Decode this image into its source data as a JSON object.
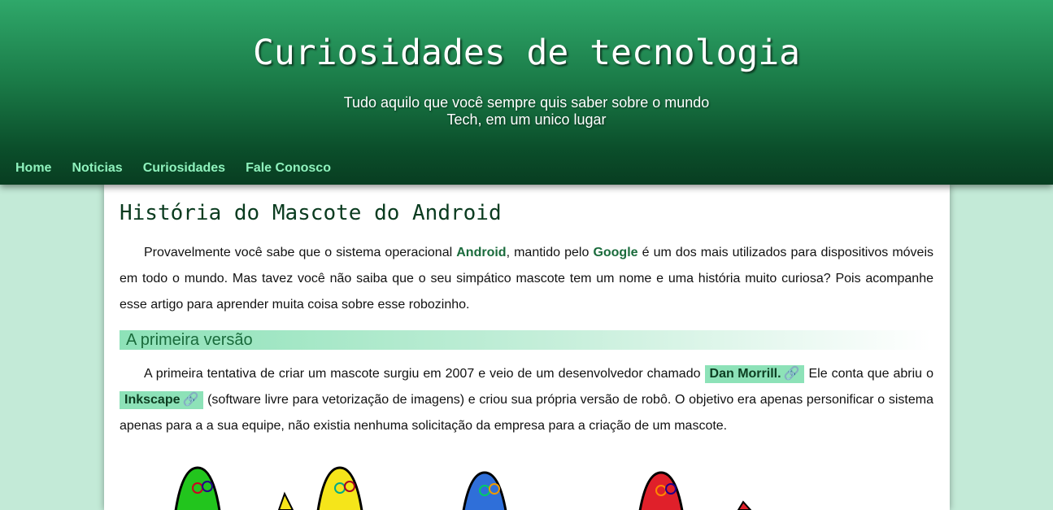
{
  "header": {
    "title": "Curiosidades de tecnologia",
    "subtitle_line1": "Tudo aquilo que você sempre quis saber sobre o mundo",
    "subtitle_line2": "Tech, em um unico lugar"
  },
  "nav": {
    "items": [
      "Home",
      "Noticias",
      "Curiosidades",
      "Fale Conosco"
    ]
  },
  "article": {
    "title": "História do Mascote do Android",
    "intro": {
      "t1": "Provavelmente você sabe que o sistema operacional ",
      "brand1": "Android",
      "t2": ", mantido pelo ",
      "brand2": "Google",
      "t3": " é um dos mais utilizados para dispositivos móveis em todo o mundo. Mas tavez você não saiba que o seu simpático mascote tem um nome e uma história muito curiosa? Pois acompanhe esse artigo para aprender muita coisa sobre esse robozinho."
    },
    "section1": {
      "heading": "A primeira versão",
      "t1": "A primeira tentativa de criar um mascote surgiu em 2007 e veio de um desenvolvedor chamado ",
      "link1": "Dan Morrill.",
      "t2": " Ele conta que abriu o ",
      "link2": "Inkscape",
      "t3": " (software livre para vetorização de imagens) e criou sua própria versão de robô. O objetivo era apenas personificar o sistema apenas para a a sua equipe, não existia nenhuma solicitação da empresa para a criação de um mascote."
    },
    "robot_colors": [
      "#22c51d",
      "#f5e51a",
      "#2f6fd9",
      "#e0202a"
    ]
  },
  "colors": {
    "accent": "#1a6b3c",
    "nav_link": "#8ff2bd",
    "tag_bg": "#8de2b8",
    "page_bg": "#c3ead7"
  }
}
